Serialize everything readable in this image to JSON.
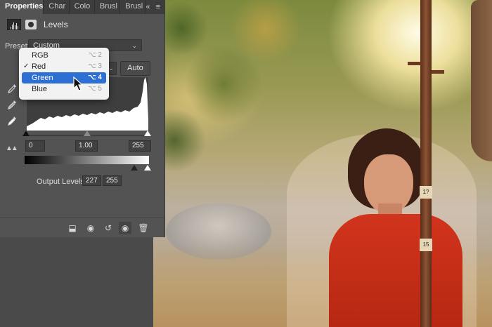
{
  "tabs": [
    {
      "label": "Properties",
      "active": true
    },
    {
      "label": "Char",
      "active": false
    },
    {
      "label": "Colo",
      "active": false
    },
    {
      "label": "Brusl",
      "active": false
    },
    {
      "label": "Brusl",
      "active": false
    }
  ],
  "tab_controls": {
    "collapse": "«",
    "menu": "≡"
  },
  "panel": {
    "title": "Levels",
    "preset_label": "Preset:",
    "preset_value": "Custom",
    "auto_label": "Auto"
  },
  "channel_menu": {
    "items": [
      {
        "label": "RGB",
        "shortcut": "⌥ 2",
        "checked": false,
        "highlighted": false
      },
      {
        "label": "Red",
        "shortcut": "⌥ 3",
        "checked": true,
        "highlighted": false
      },
      {
        "label": "Green",
        "shortcut": "⌥ 4",
        "checked": false,
        "highlighted": true
      },
      {
        "label": "Blue",
        "shortcut": "⌥ 5",
        "checked": false,
        "highlighted": false
      }
    ],
    "check_mark": "✓"
  },
  "input_levels": {
    "black": "0",
    "gamma": "1.00",
    "white": "255"
  },
  "output_levels": {
    "label": "Output Levels:",
    "black": "227",
    "white": "255"
  },
  "photo_text": {
    "band_1": "1?",
    "band_2": "15"
  },
  "colors": {
    "panel_bg": "#535353",
    "highlight": "#2d6fd3",
    "dress": "#d2341c"
  },
  "icons": [
    "levels-icon",
    "mask-icon",
    "eyedropper-black-icon",
    "eyedropper-gray-icon",
    "eyedropper-white-icon",
    "clip-warning-icon",
    "clip-to-layer-icon",
    "view-previous-icon",
    "reset-icon",
    "visibility-icon",
    "trash-icon",
    "mouse-pointer-icon"
  ]
}
